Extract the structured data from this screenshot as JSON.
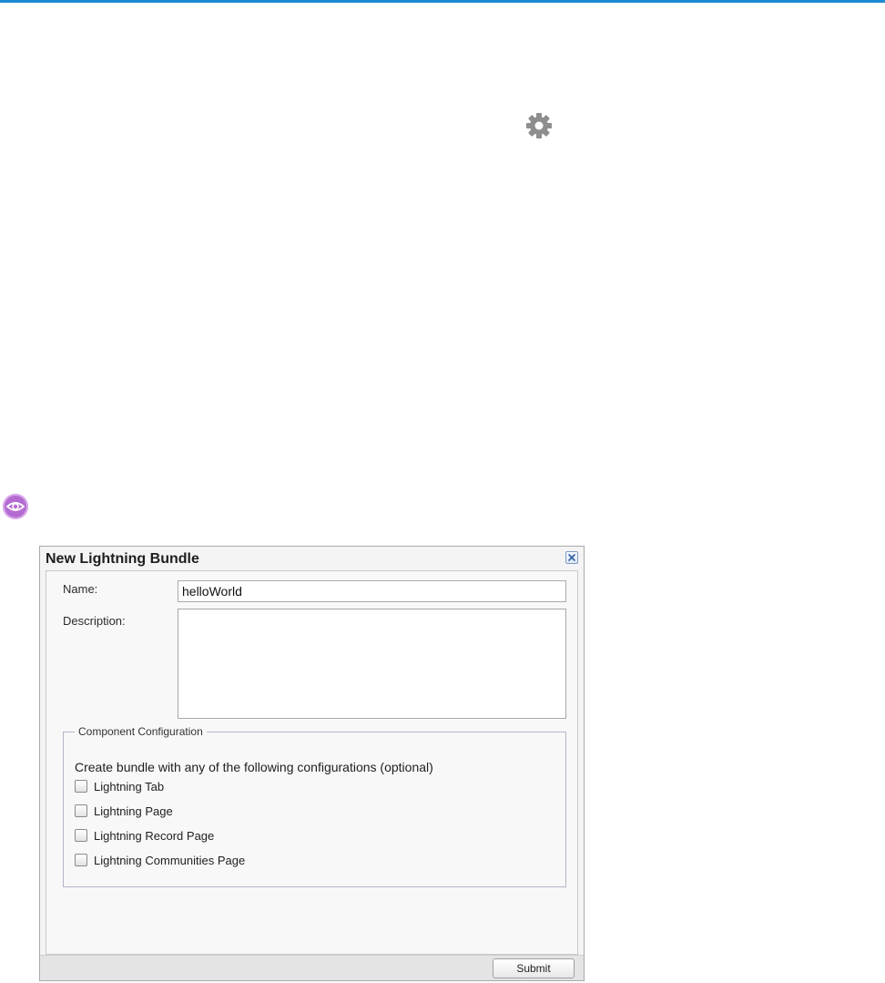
{
  "icons": {
    "gear": "gear-icon",
    "preview": "eye-icon",
    "close": "close-icon"
  },
  "colors": {
    "top_bar": "#1b8ad3",
    "badge": "#b46bd1",
    "gear": "#8e8e8e"
  },
  "dialog": {
    "title": "New Lightning Bundle",
    "name_label": "Name:",
    "name_value": "helloWorld",
    "description_label": "Description:",
    "description_value": "",
    "config_legend": "Component Configuration",
    "config_intro": "Create bundle with any of the following configurations (optional)",
    "options": [
      {
        "label": "Lightning Tab",
        "checked": false
      },
      {
        "label": "Lightning Page",
        "checked": false
      },
      {
        "label": "Lightning Record Page",
        "checked": false
      },
      {
        "label": "Lightning Communities Page",
        "checked": false
      }
    ],
    "submit_label": "Submit"
  }
}
